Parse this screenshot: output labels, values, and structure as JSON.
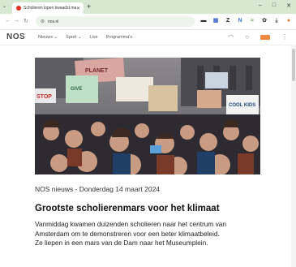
{
  "browser": {
    "tab_title": "Scholieren lopen kwaadst mars",
    "new_tab_symbol": "+",
    "url": "nos.nl",
    "window_controls": [
      "–",
      "□",
      "✕"
    ]
  },
  "site": {
    "logo": "NOS",
    "nav": [
      "Nieuws ⌄",
      "Sport ⌄",
      "Live",
      "Programma's"
    ]
  },
  "photo": {
    "signs": [
      "PLANET",
      "STOP",
      "COOL KIDS",
      "GIVE"
    ]
  },
  "article": {
    "meta": "NOS nieuws - Donderdag 14 maart 2024",
    "headline": "Grootste scholierenmars voor het klimaat",
    "body_lines": [
      "Vanmiddag kwamen duizenden scholieren naar het centrum van",
      "Amsterdam om te demonstreren voor een beter klimaatbeleid.",
      "Ze liepen in een mars van de Dam naar het Museumplein."
    ]
  },
  "colors": {
    "tabbar": "#d6e8cf",
    "accent_red": "#e0301e",
    "live_orange": "#f08a3e"
  }
}
